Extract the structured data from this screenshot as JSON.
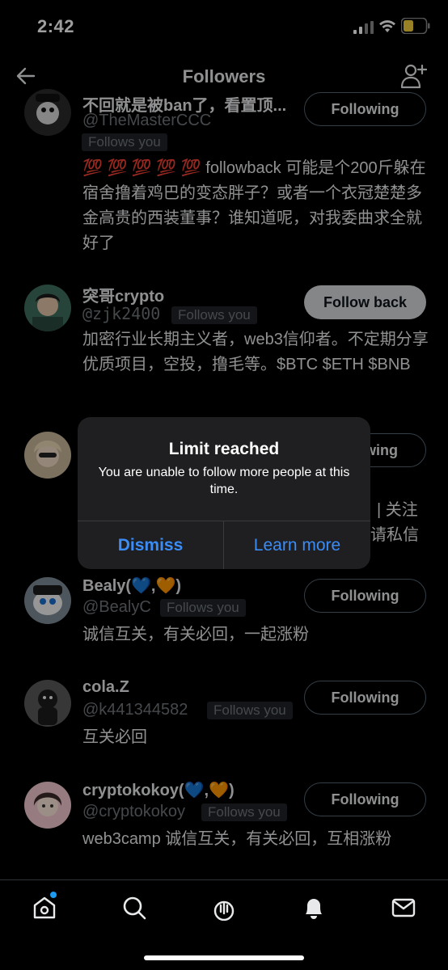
{
  "status_bar": {
    "time": "2:42"
  },
  "header": {
    "title": "Followers"
  },
  "followers": [
    {
      "username": "不回就是被ban了，看置顶...",
      "handle": "@TheMasterCCC",
      "badge": "Follows you",
      "bio": "💯 💯 💯 💯 💯 followback 可能是个200斤躲在宿舍撸着鸡巴的变态胖子？或者一个衣冠楚楚多金高贵的西装董事？谁知道呢，对我委曲求全就好了",
      "button": "Following"
    },
    {
      "username": "突哥crypto",
      "handle": "@zjk2400",
      "badge": "Follows you",
      "bio": "加密行业长期主义者，web3信仰者。不定期分享优质项目，空投，撸毛等。$BTC $ETH $BNB",
      "button": "Follow back"
    },
    {
      "bio_fragment_1": "| 关注",
      "bio_fragment_2": "请私信",
      "button": "wing"
    },
    {
      "username": "Bealy(💙,🧡)",
      "handle": "@BealyC",
      "badge": "Follows you",
      "bio": "诚信互关，有关必回，一起涨粉",
      "button": "Following"
    },
    {
      "username": "cola.Z",
      "handle": "@k441344582",
      "badge": "Follows you",
      "bio": "互关必回",
      "button": "Following"
    },
    {
      "username": "cryptokokoy(💙,🧡)",
      "handle": "@cryptokokoy",
      "badge": "Follows you",
      "bio": "web3camp 诚信互关，有关必回，互相涨粉",
      "button": "Following"
    }
  ],
  "alert": {
    "title": "Limit reached",
    "message": "You are unable to follow more people at this time.",
    "dismiss_label": "Dismiss",
    "learn_more_label": "Learn more"
  },
  "tab_bar": {
    "icons": [
      "home-icon",
      "search-icon",
      "spaces-icon",
      "notifications-icon",
      "messages-icon"
    ]
  },
  "colors": {
    "accent": "#1d9bf0",
    "alert_button": "#3b8cf5",
    "background": "#000000"
  }
}
